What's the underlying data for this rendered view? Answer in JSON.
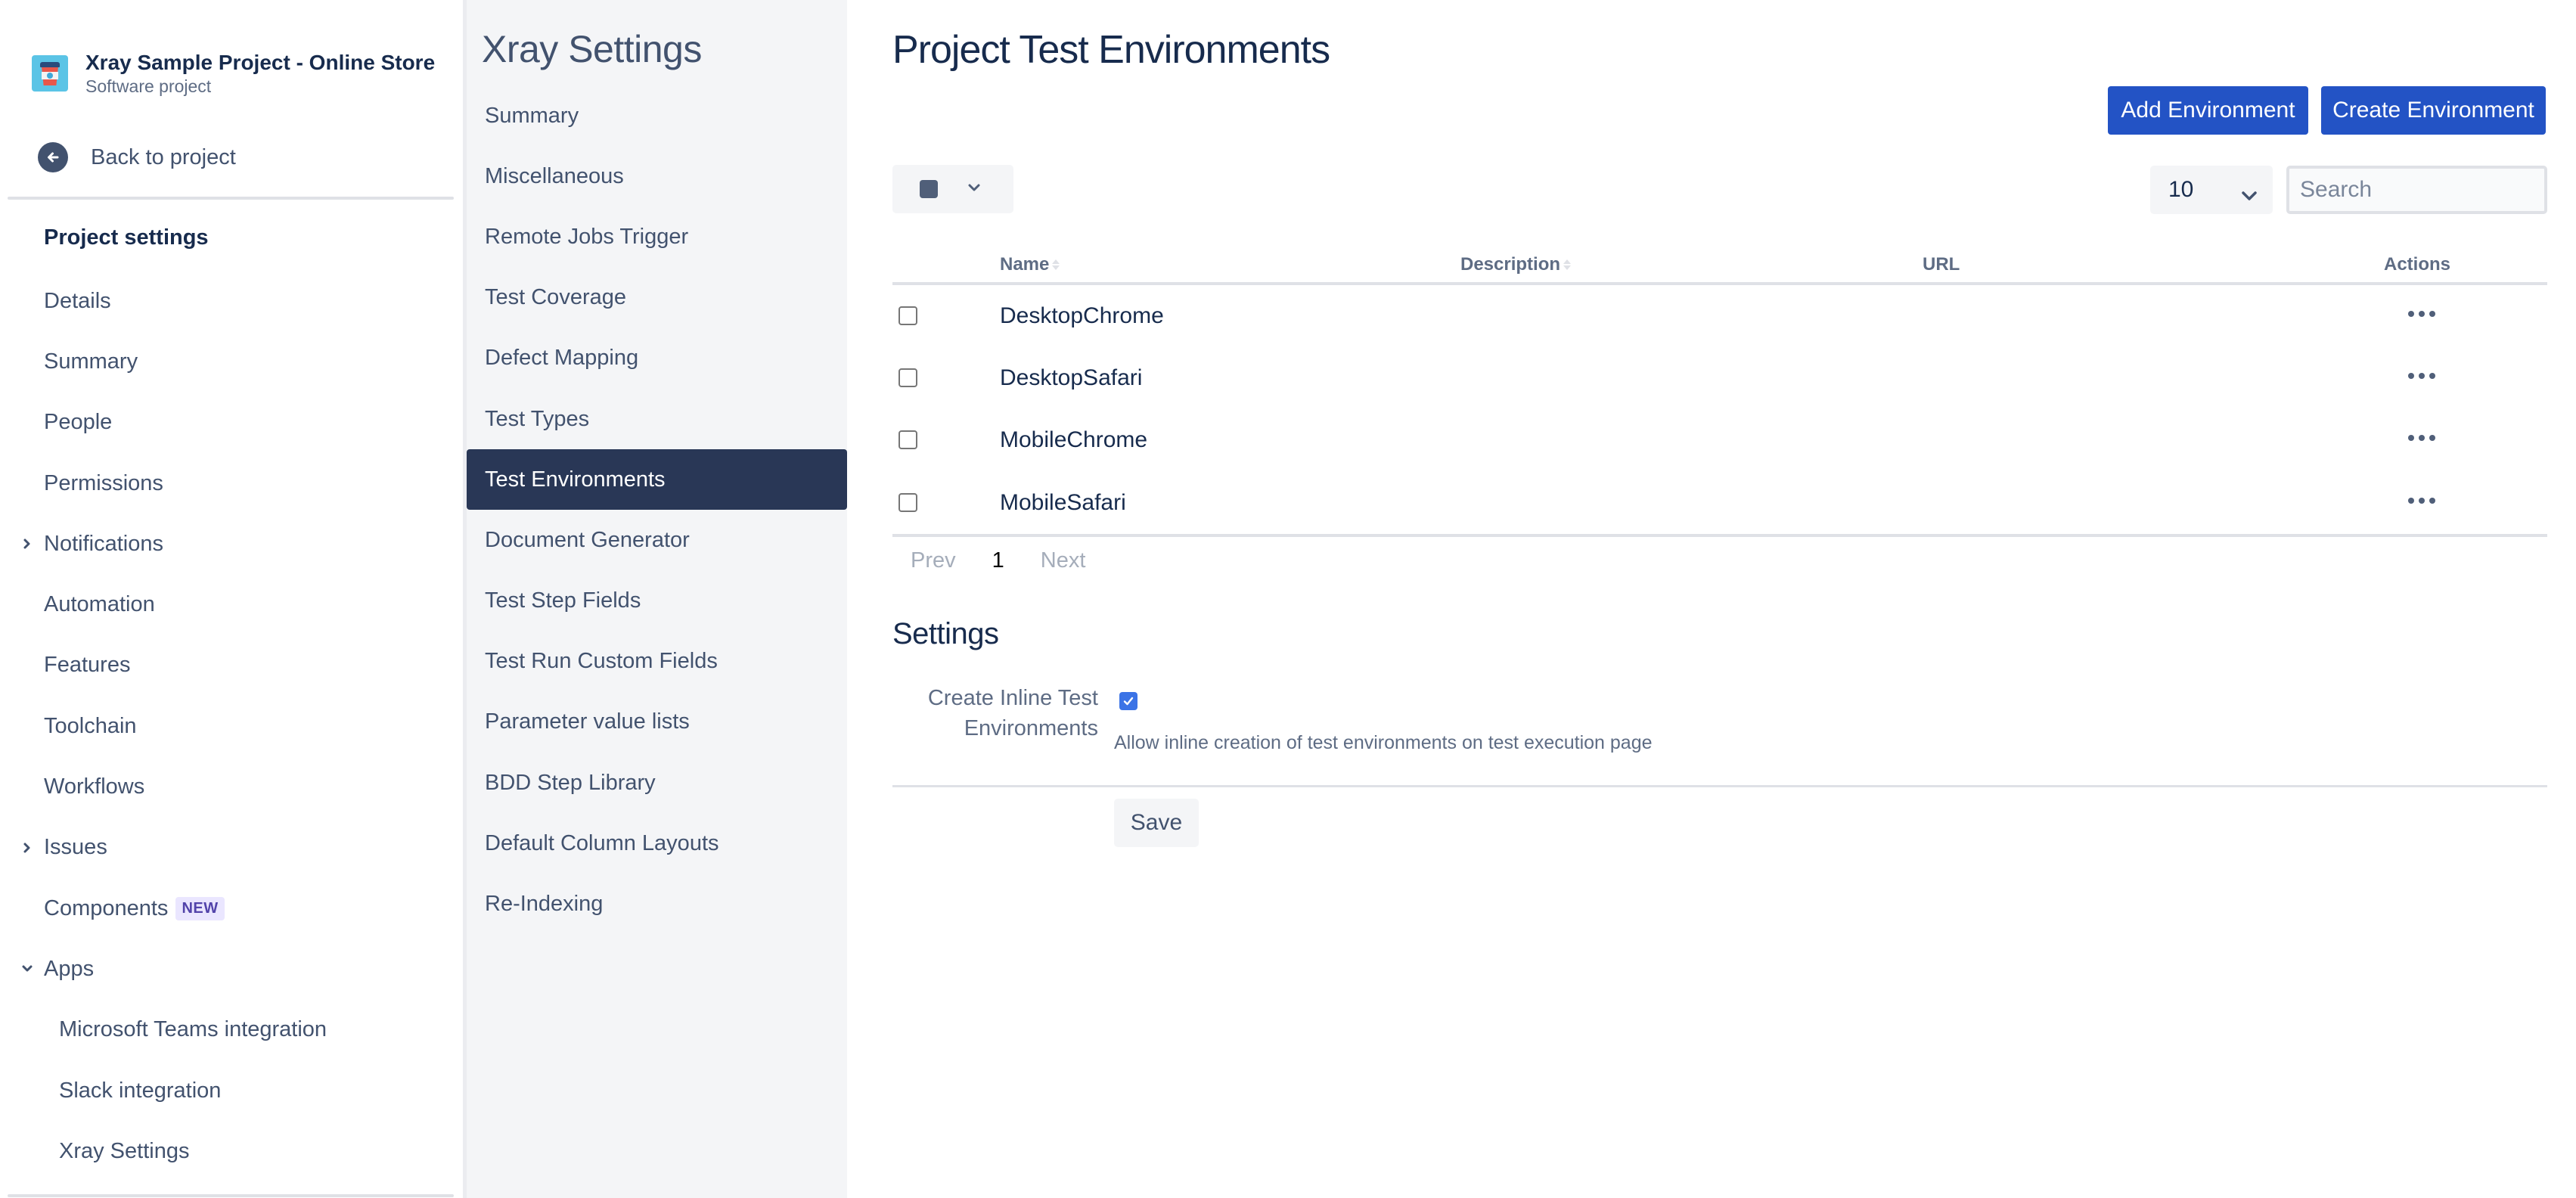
{
  "project": {
    "name": "Xray Sample Project - Online Store",
    "type": "Software project",
    "back_label": "Back to project"
  },
  "project_settings": {
    "title": "Project settings",
    "items": [
      {
        "label": "Details",
        "expander": ""
      },
      {
        "label": "Summary",
        "expander": ""
      },
      {
        "label": "People",
        "expander": ""
      },
      {
        "label": "Permissions",
        "expander": ""
      },
      {
        "label": "Notifications",
        "expander": "collapsed"
      },
      {
        "label": "Automation",
        "expander": ""
      },
      {
        "label": "Features",
        "expander": ""
      },
      {
        "label": "Toolchain",
        "expander": ""
      },
      {
        "label": "Workflows",
        "expander": ""
      },
      {
        "label": "Issues",
        "expander": "collapsed"
      },
      {
        "label": "Components",
        "expander": "",
        "badge": "NEW"
      },
      {
        "label": "Apps",
        "expander": "expanded"
      },
      {
        "label": "Microsoft Teams integration",
        "sub": true
      },
      {
        "label": "Slack integration",
        "sub": true
      },
      {
        "label": "Xray Settings",
        "sub": true
      }
    ]
  },
  "xray_settings": {
    "title": "Xray Settings",
    "items": [
      "Summary",
      "Miscellaneous",
      "Remote Jobs Trigger",
      "Test Coverage",
      "Defect Mapping",
      "Test Types",
      "Test Environments",
      "Document Generator",
      "Test Step Fields",
      "Test Run Custom Fields",
      "Parameter value lists",
      "BDD Step Library",
      "Default Column Layouts",
      "Re-Indexing"
    ],
    "active": "Test Environments"
  },
  "main": {
    "title": "Project Test Environments",
    "add_button": "Add Environment",
    "create_button": "Create Environment",
    "page_size": "10",
    "search_placeholder": "Search",
    "search_value": "",
    "columns": {
      "name": "Name",
      "description": "Description",
      "url": "URL",
      "actions": "Actions"
    },
    "rows": [
      {
        "name": "DesktopChrome",
        "description": "",
        "url": "",
        "checked": false
      },
      {
        "name": "DesktopSafari",
        "description": "",
        "url": "",
        "checked": false
      },
      {
        "name": "MobileChrome",
        "description": "",
        "url": "",
        "checked": false
      },
      {
        "name": "MobileSafari",
        "description": "",
        "url": "",
        "checked": false
      }
    ],
    "pagination": {
      "prev": "Prev",
      "current": "1",
      "next": "Next"
    },
    "settings": {
      "title": "Settings",
      "label_line1": "Create Inline Test",
      "label_line2": "Environments",
      "checked": true,
      "description": "Allow inline creation of test environments on test execution page",
      "save_label": "Save"
    }
  },
  "colors": {
    "primary": "#2353c5",
    "active_nav": "#293756",
    "panel_bg": "#f4f5f7",
    "checkbox": "#3b73e6",
    "badge_text": "#5243aa",
    "badge_bg": "#eae6ff"
  }
}
